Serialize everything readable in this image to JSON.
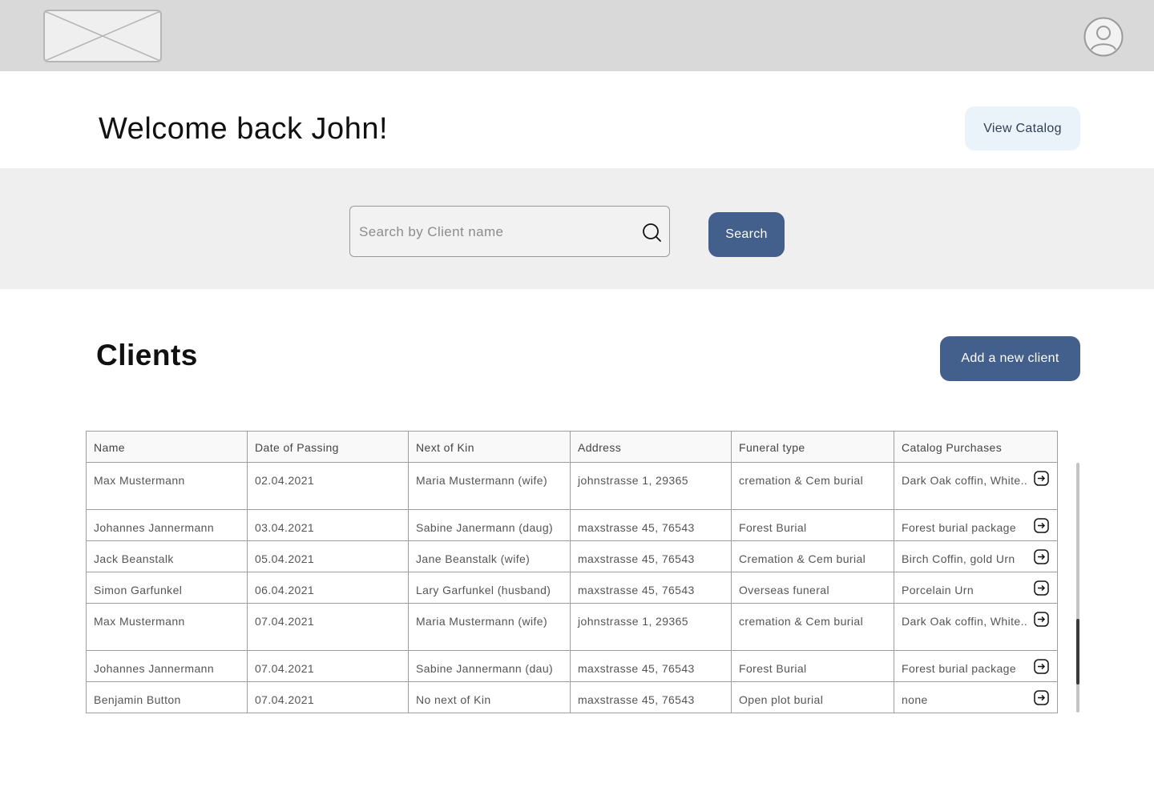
{
  "header": {
    "logo_icon": "image-placeholder-icon",
    "avatar_icon": "user-avatar-icon"
  },
  "welcome": {
    "title": "Welcome back John!",
    "catalog_button": "View Catalog"
  },
  "search": {
    "placeholder": "Search by Client name",
    "value": "",
    "icon": "search-icon",
    "button": "Search"
  },
  "clients": {
    "title": "Clients",
    "add_button": "Add a new client",
    "columns": [
      "Name",
      "Date of Passing",
      "Next of Kin",
      "Address",
      "Funeral type",
      "Catalog Purchases"
    ],
    "rows": [
      {
        "name": "Max Mustermann",
        "date": "02.04.2021",
        "kin": "Maria Mustermann (wife)",
        "address": "johnstrasse 1, 29365",
        "funeral": "cremation & Cem burial",
        "purchases": "Dark Oak coffin, White.."
      },
      {
        "name": "Johannes Jannermann",
        "date": "03.04.2021",
        "kin": "Sabine Janermann (daug)",
        "address": "maxstrasse 45, 76543",
        "funeral": "Forest Burial",
        "purchases": "Forest burial package"
      },
      {
        "name": "Jack Beanstalk",
        "date": "05.04.2021",
        "kin": "Jane Beanstalk (wife)",
        "address": "maxstrasse 45, 76543",
        "funeral": "Cremation & Cem burial",
        "purchases": "Birch Coffin, gold Urn"
      },
      {
        "name": "Simon Garfunkel",
        "date": "06.04.2021",
        "kin": "Lary Garfunkel (husband)",
        "address": "maxstrasse 45, 76543",
        "funeral": "Overseas funeral",
        "purchases": "Porcelain Urn"
      },
      {
        "name": "Max Mustermann",
        "date": "07.04.2021",
        "kin": "Maria Mustermann (wife)",
        "address": "johnstrasse 1, 29365",
        "funeral": "cremation & Cem burial",
        "purchases": "Dark Oak coffin, White.."
      },
      {
        "name": "Johannes Jannermann",
        "date": "07.04.2021",
        "kin": "Sabine Jannermann (dau)",
        "address": "maxstrasse 45, 76543",
        "funeral": "Forest Burial",
        "purchases": "Forest burial package"
      },
      {
        "name": "Benjamin Button",
        "date": "07.04.2021",
        "kin": "No next of Kin",
        "address": "maxstrasse 45, 76543",
        "funeral": "Open plot burial",
        "purchases": "none"
      }
    ],
    "row_action_icon": "arrow-right-box-icon"
  },
  "colors": {
    "primary": "#435f8c",
    "secondary_button": "#eaf2fa",
    "topbar": "#d9d9d9",
    "search_band": "#efefef"
  }
}
